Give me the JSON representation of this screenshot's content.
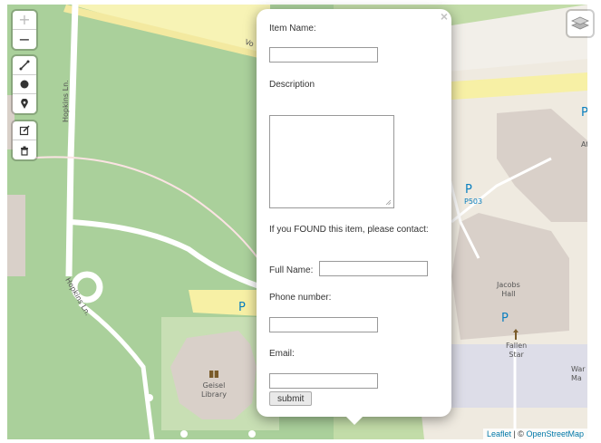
{
  "map": {
    "labels": {
      "street1": "Hopkins Ln.",
      "street2": "Hopkins Ln.",
      "street3": "Vo",
      "parking_code": "P503",
      "building1": "Jacobs\nHall",
      "building2": "Fallen\nStar",
      "building3": "Geisel\nLibrary",
      "building4": "War\nMa",
      "building5": "At"
    },
    "parking_symbol": "P",
    "attribution_leaflet": "Leaflet",
    "attribution_sep": " | © ",
    "attribution_osm": "OpenStreetMap"
  },
  "controls": {
    "zoom_in": "+",
    "zoom_out": "−"
  },
  "popup": {
    "close": "×",
    "item_name_label": "Item Name:",
    "description_label": "Description",
    "found_text": "If you FOUND this item, please contact:",
    "full_name_label": "Full Name:",
    "phone_label": "Phone number:",
    "email_label": "Email:",
    "submit_label": "submit"
  }
}
